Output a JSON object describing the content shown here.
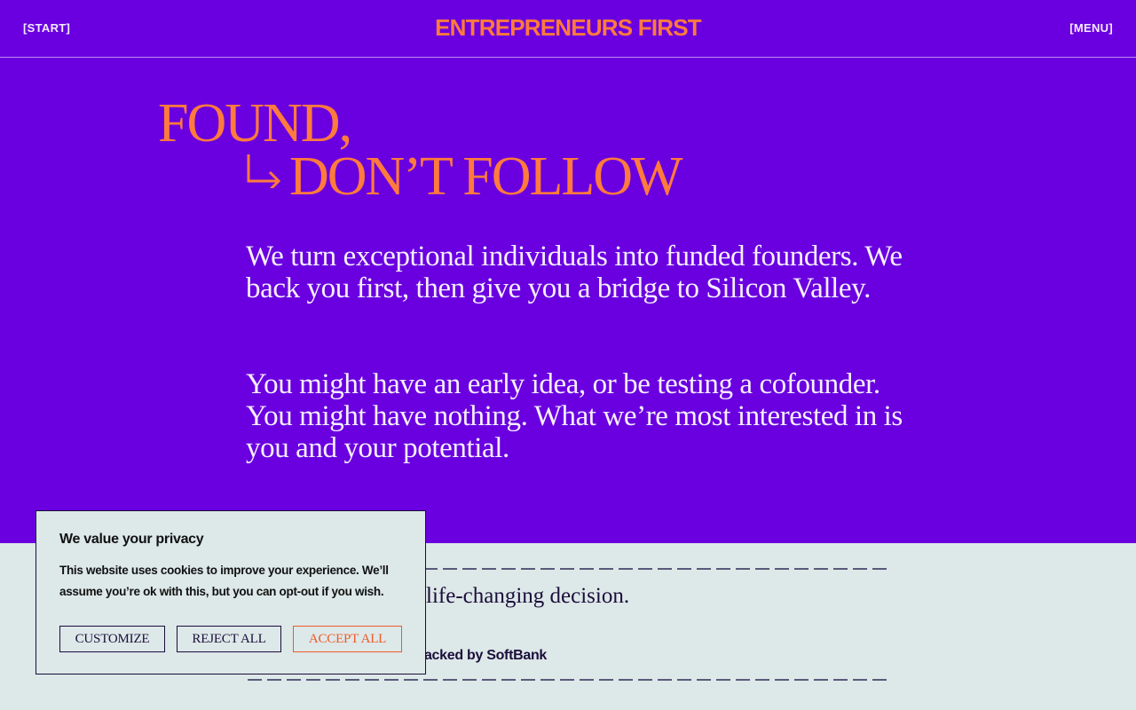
{
  "header": {
    "start_label": "[START]",
    "logo": "ENTREPRENEURS FIRST",
    "menu_label": "[MENU]"
  },
  "hero": {
    "headline_line1": "FOUND,",
    "headline_line2": "DON’T FOLLOW",
    "headline_icon": "return-arrow-icon",
    "paragraph_1": "We turn exceptional individuals into funded founders. We back you first, then give you a bridge to Silicon Valley.",
    "paragraph_2": "You might have an early idea, or be testing a cofounder. You might have nothing. What we’re most interested in is you and your potential."
  },
  "lower": {
    "text_partial": "life-changing decision.",
    "subtext_partial": "ve, backed by SoftBank"
  },
  "cookie_banner": {
    "title": "We value your privacy",
    "body": "This website uses cookies to improve your experience. We’ll assume you’re ok with this, but you can opt-out if you wish.",
    "customize_label": "CUSTOMIZE",
    "reject_label": "REJECT ALL",
    "accept_label": "ACCEPT ALL"
  },
  "colors": {
    "hero_background": "#6a00e0",
    "accent_orange": "#ff7a3d",
    "page_background": "#dde8e8",
    "dark_text": "#1b0e3a"
  }
}
